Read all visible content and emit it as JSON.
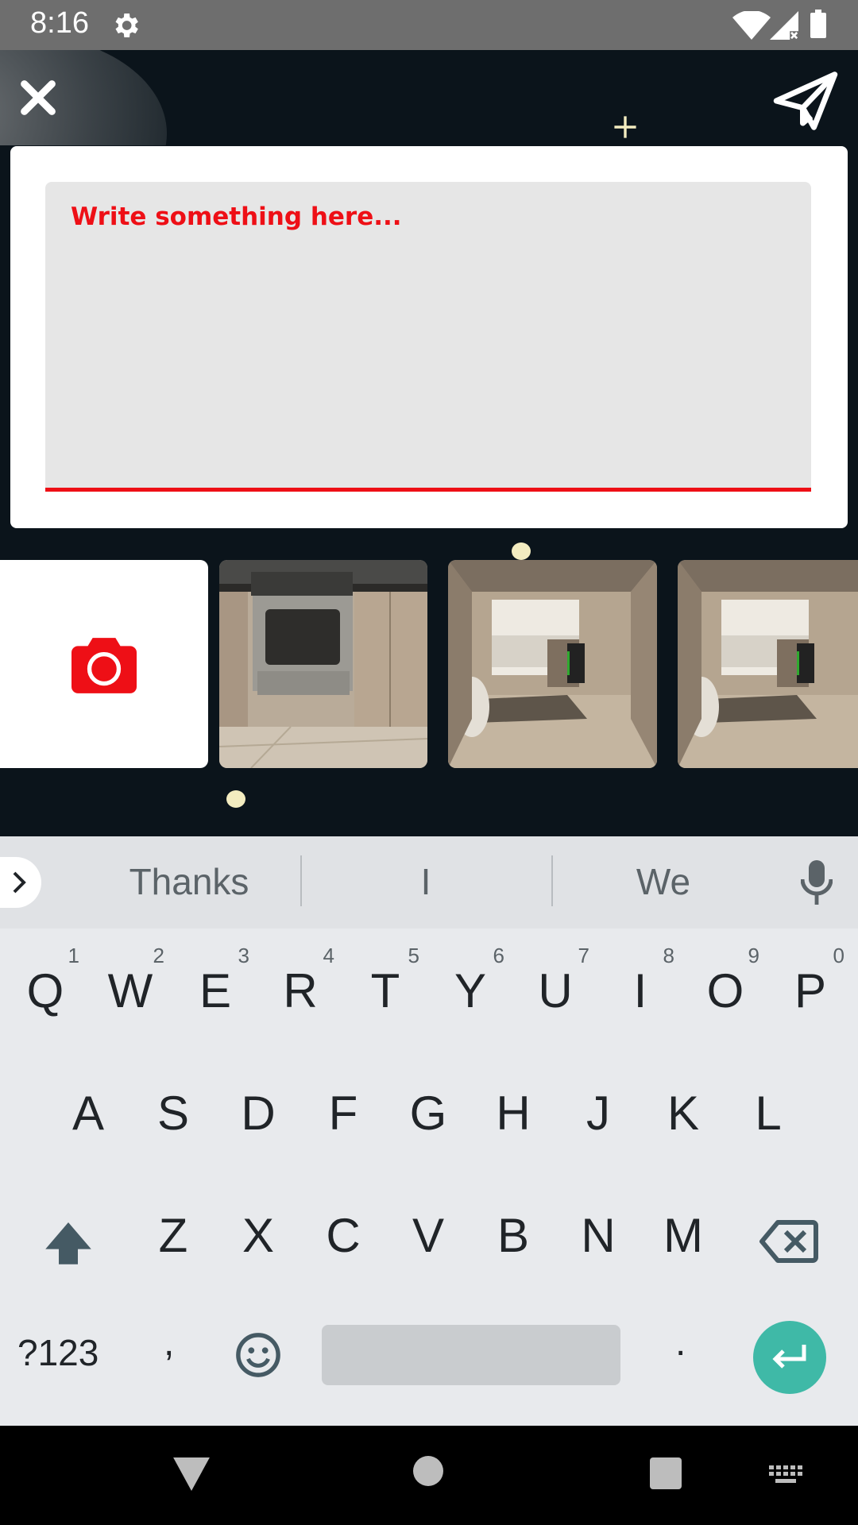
{
  "status_bar": {
    "time": "8:16"
  },
  "composer": {
    "placeholder": "Write something here..."
  },
  "keyboard": {
    "suggestions": [
      "Thanks",
      "I",
      "We"
    ],
    "row1": [
      {
        "key": "Q",
        "hint": "1"
      },
      {
        "key": "W",
        "hint": "2"
      },
      {
        "key": "E",
        "hint": "3"
      },
      {
        "key": "R",
        "hint": "4"
      },
      {
        "key": "T",
        "hint": "5"
      },
      {
        "key": "Y",
        "hint": "6"
      },
      {
        "key": "U",
        "hint": "7"
      },
      {
        "key": "I",
        "hint": "8"
      },
      {
        "key": "O",
        "hint": "9"
      },
      {
        "key": "P",
        "hint": "0"
      }
    ],
    "row2": [
      "A",
      "S",
      "D",
      "F",
      "G",
      "H",
      "J",
      "K",
      "L"
    ],
    "row3": [
      "Z",
      "X",
      "C",
      "V",
      "B",
      "N",
      "M"
    ],
    "symbols_label": "?123",
    "comma_label": ",",
    "period_label": "."
  },
  "colors": {
    "accent": "#ee0f16",
    "background": "#0b141b",
    "enter": "#3fb9a7"
  },
  "icons": [
    "close-icon",
    "send-icon",
    "camera-icon",
    "mic-icon",
    "shift-icon",
    "backspace-icon",
    "emoji-icon",
    "enter-icon"
  ]
}
